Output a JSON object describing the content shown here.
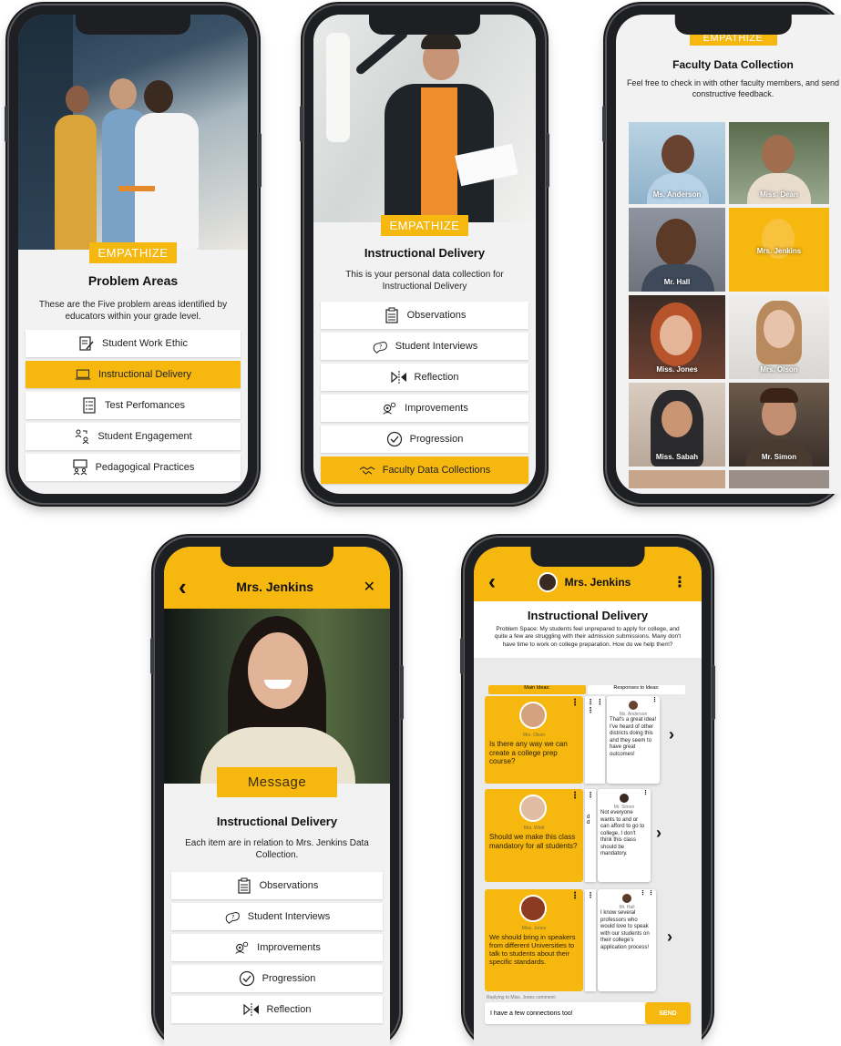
{
  "phone1": {
    "tag": "EMPATHIZE",
    "title": "Problem Areas",
    "description": "These are the Five problem areas identified by educators within your grade level.",
    "items": [
      {
        "label": "Student Work Ethic",
        "icon": "clipboard-pen-icon",
        "active": false
      },
      {
        "label": "Instructional Delivery",
        "icon": "laptop-icon",
        "active": true
      },
      {
        "label": "Test Perfomances",
        "icon": "checklist-icon",
        "active": false
      },
      {
        "label": "Student Engagement",
        "icon": "people-exchange-icon",
        "active": false
      },
      {
        "label": "Pedagogical Practices",
        "icon": "presentation-icon",
        "active": false
      }
    ]
  },
  "phone2": {
    "tag": "EMPATHIZE",
    "title": "Instructional Delivery",
    "description": "This is your personal data collection for Instructional Delivery",
    "items": [
      {
        "label": "Observations",
        "icon": "clipboard-icon",
        "active": false
      },
      {
        "label": "Student Interviews",
        "icon": "speech-question-icon",
        "active": false
      },
      {
        "label": "Reflection",
        "icon": "reflection-icon",
        "active": false
      },
      {
        "label": "Improvements",
        "icon": "gears-head-icon",
        "active": false
      },
      {
        "label": "Progression",
        "icon": "check-circle-icon",
        "active": false
      },
      {
        "label": "Faculty Data Collections",
        "icon": "handshake-icon",
        "active": true
      }
    ]
  },
  "phone3": {
    "tag": "EMPATHIZE",
    "title": "Faculty Data Collection",
    "description": "Feel free to check in with other faculty members, and send constructive feedback.",
    "faculty": [
      {
        "name": "Ms. Anderson",
        "highlighted": false
      },
      {
        "name": "Miss. Dean",
        "highlighted": false
      },
      {
        "name": "Mr. Hall",
        "highlighted": false
      },
      {
        "name": "Mrs. Jenkins",
        "highlighted": true
      },
      {
        "name": "Miss. Jones",
        "highlighted": false
      },
      {
        "name": "Mrs. Olson",
        "highlighted": false
      },
      {
        "name": "Miss. Sabah",
        "highlighted": false
      },
      {
        "name": "Mr. Simon",
        "highlighted": false
      }
    ]
  },
  "phone4": {
    "header": {
      "title": "Mrs. Jenkins",
      "back": "‹",
      "close": "✕"
    },
    "tag": "Message",
    "title": "Instructional Delivery",
    "description": "Each item are in relation to Mrs. Jenkins Data Collection.",
    "items": [
      {
        "label": "Observations",
        "icon": "clipboard-icon"
      },
      {
        "label": "Student Interviews",
        "icon": "speech-question-icon"
      },
      {
        "label": "Improvements",
        "icon": "gears-head-icon"
      },
      {
        "label": "Progression",
        "icon": "check-circle-icon"
      },
      {
        "label": "Reflection",
        "icon": "reflection-icon"
      }
    ]
  },
  "phone5": {
    "header": {
      "title": "Mrs. Jenkins",
      "back": "‹",
      "menu": "⋮"
    },
    "title": "Instructional Delivery",
    "problem": "Problem Space: My students feel unprepared to apply for college, and quite a few are struggling with their admission submissions. Many don't have time to work on college preparation. How do we help them?",
    "tabs": {
      "main": "Main Ideas:",
      "responses": "Responses to Ideas:"
    },
    "threads": [
      {
        "author": "Mrs. Olson",
        "idea": "Is there any way we can create a college prep course?",
        "reply_author": "Ms. Anderson",
        "reply": "That's a great idea! I've heard of other districts doing this and they seem to have great outcomes!",
        "peek": ""
      },
      {
        "author": "Mrs. Whitt",
        "idea": "Should we make this class mandatory for all students?",
        "reply_author": "Mr. Simon",
        "reply": "Not everyone wants to and or can afford to go to college. I don't think this class should be mandatory.",
        "peek": "d\nd"
      },
      {
        "author": "Miss. Jones",
        "idea": "We should bring in speakers from different Universities to talk to students about their specific standards.",
        "reply_author": "Mr. Hall",
        "reply": "I know several professors who would love to speak with our students on their college's application process!",
        "peek": ""
      }
    ],
    "replying_to": "Replying to Miss. Jones comment:",
    "input_value": "I have a few connections too!",
    "send": "SEND"
  },
  "colors": {
    "accent": "#f6b70f",
    "phone": "#1e1f22",
    "screen_bg": "#f2f2f2"
  }
}
